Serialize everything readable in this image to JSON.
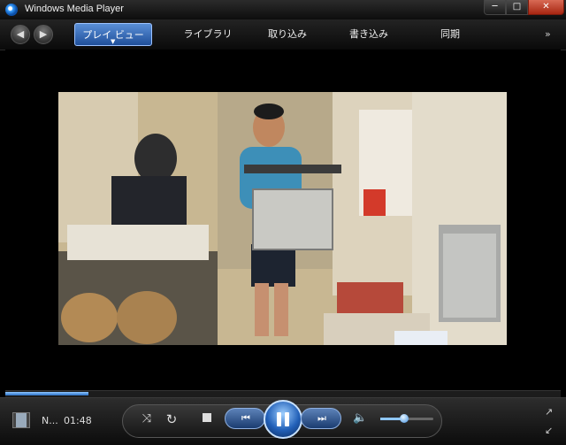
{
  "window": {
    "title": "Windows Media Player"
  },
  "titlebar": {
    "minimize": "─",
    "maximize": "□",
    "close": "✕"
  },
  "nav": {
    "back_icon": "◀",
    "forward_icon": "▶",
    "tabs": [
      {
        "label": "プレイ ビュー",
        "active": true
      },
      {
        "label": "ライブラリ"
      },
      {
        "label": "取り込み"
      },
      {
        "label": "書き込み"
      },
      {
        "label": "同期"
      }
    ],
    "active_caret": "▼",
    "more": "»"
  },
  "seek": {
    "progress_percent": 15
  },
  "now_playing": {
    "title": "N...",
    "time": "01:48"
  },
  "controls": {
    "shuffle_icon": "⤨",
    "repeat_icon": "↻",
    "prev_icon": "⏮",
    "next_icon": "⏭",
    "volume_icon": "🔈",
    "switch_icon": "↗",
    "fullscreen_icon": "↙",
    "volume_percent": 45
  },
  "colors": {
    "accent": "#2a6fc4",
    "close": "#c0392b"
  }
}
